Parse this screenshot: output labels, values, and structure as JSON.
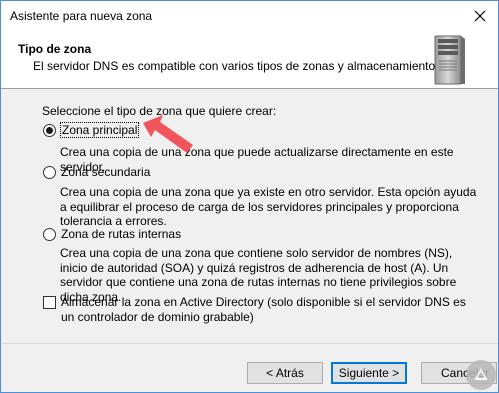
{
  "window": {
    "title": "Asistente para nueva zona"
  },
  "header": {
    "title": "Tipo de zona",
    "subtitle": "El servidor DNS es compatible con varios tipos de zonas y almacenamientos."
  },
  "body": {
    "prompt": "Seleccione el tipo de zona que quiere crear:",
    "options": [
      {
        "label": "Zona principal",
        "selected": true,
        "description": "Crea una copia de una zona que puede actualizarse directamente en este servidor."
      },
      {
        "label": "Zona secundaria",
        "selected": false,
        "description": "Crea una copia de una zona que ya existe en otro servidor. Esta opción ayuda a equilibrar el proceso de carga de los servidores principales y proporciona tolerancia a errores."
      },
      {
        "label": "Zona de rutas internas",
        "selected": false,
        "description": "Crea una copia de una zona que contiene solo servidor de nombres (NS), inicio de autoridad (SOA) y quizá registros de adherencia de host (A). Un servidor que contiene una zona de rutas internas no tiene privilegios sobre dicha zona."
      }
    ],
    "ad_checkbox": {
      "label": "Almacenar la zona en Active Directory (solo disponible si el servidor DNS es un controlador de dominio grabable)",
      "checked": false
    }
  },
  "footer": {
    "back_label": "< Atrás",
    "next_label": "Siguiente >",
    "cancel_label": "Cancelar"
  },
  "icons": {
    "close": "close-icon",
    "server": "server-icon",
    "arrow": "red-arrow-annotation",
    "watermark": "watermark-logo"
  },
  "colors": {
    "accent": "#0078d7",
    "arrow": "#f2545b",
    "header_bg": "#ffffff",
    "dialog_bg": "#f0f0f0"
  }
}
